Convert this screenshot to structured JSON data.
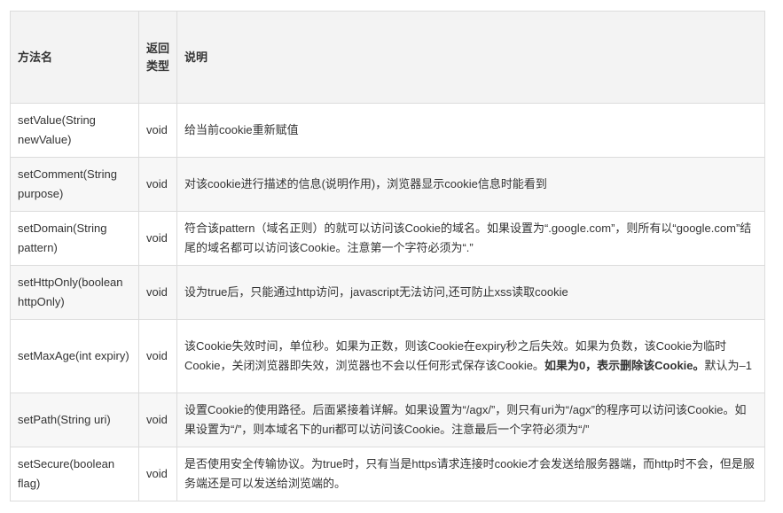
{
  "table": {
    "headers": {
      "method": "方法名",
      "return_type": "返回类型",
      "desc": "说明"
    },
    "rows": [
      {
        "method": "setValue(String newValue)",
        "return_type": "void",
        "desc": "给当前cookie重新赋值"
      },
      {
        "method": "setComment(String purpose)",
        "return_type": "void",
        "desc": "对该cookie进行描述的信息(说明作用)，浏览器显示cookie信息时能看到"
      },
      {
        "method": "setDomain(String pattern)",
        "return_type": "void",
        "desc": "符合该pattern（域名正则）的就可以访问该Cookie的域名。如果设置为“.google.com”，则所有以“google.com”结尾的域名都可以访问该Cookie。注意第一个字符必须为“.”"
      },
      {
        "method": "setHttpOnly(boolean httpOnly)",
        "return_type": "void",
        "desc": "设为true后，只能通过http访问，javascript无法访问,还可防止xss读取cookie"
      },
      {
        "method": "setMaxAge(int expiry)",
        "return_type": "void",
        "desc_before": "该Cookie失效时间，单位秒。如果为正数，则该Cookie在expiry秒之后失效。如果为负数，该Cookie为临时Cookie，关闭浏览器即失效，浏览器也不会以任何形式保存该Cookie。",
        "desc_bold": "如果为0，表示删除该Cookie。",
        "desc_after": "默认为–1"
      },
      {
        "method": "setPath(String uri)",
        "return_type": "void",
        "desc": "设置Cookie的使用路径。后面紧接着详解。如果设置为“/agx/”，则只有uri为“/agx”的程序可以访问该Cookie。如果设置为“/”，则本域名下的uri都可以访问该Cookie。注意最后一个字符必须为“/”"
      },
      {
        "method": "setSecure(boolean flag)",
        "return_type": "void",
        "desc": "是否使用安全传输协议。为true时，只有当是https请求连接时cookie才会发送给服务器端，而http时不会，但是服务端还是可以发送给浏览端的。"
      }
    ]
  }
}
